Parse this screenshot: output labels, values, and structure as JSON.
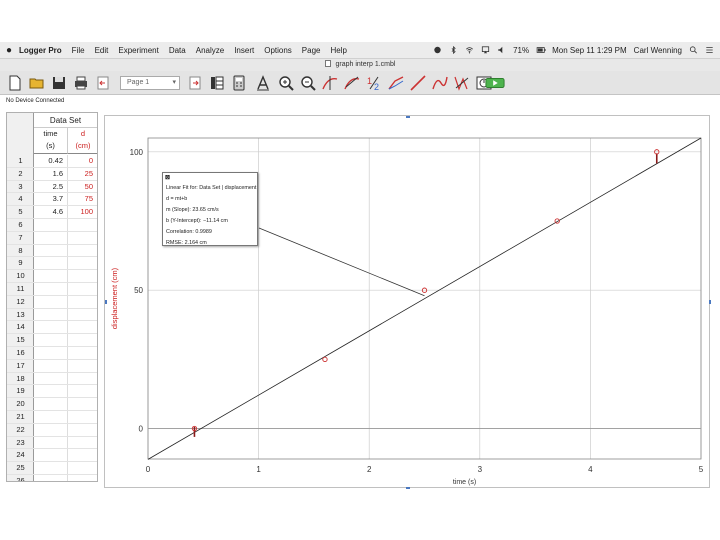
{
  "menubar": {
    "app_name": "Logger Pro",
    "items": [
      "File",
      "Edit",
      "Experiment",
      "Data",
      "Analyze",
      "Insert",
      "Options",
      "Page",
      "Help"
    ],
    "battery": "71%",
    "clock": "Mon Sep 11  1:29 PM",
    "user": "Carl Wenning"
  },
  "document": {
    "title": "graph interp 1.cmbl"
  },
  "toolbar": {
    "page_selector": "Page 1",
    "icons": [
      "new-file-icon",
      "open-folder-icon",
      "save-icon",
      "print-icon",
      "back-icon",
      "page-forward-icon",
      "data-browser-icon",
      "calculator-icon",
      "text-annotation-icon",
      "zoom-in-icon",
      "zoom-out-icon",
      "examine-icon",
      "tangent-icon",
      "integral-icon",
      "stats-icon",
      "linear-fit-icon",
      "curve-fit-icon",
      "model-icon",
      "replay-icon",
      "collect-icon"
    ]
  },
  "status": {
    "connection": "No Device Connected"
  },
  "table": {
    "title": "Data Set",
    "columns": [
      {
        "name": "time",
        "unit": "(s)"
      },
      {
        "name": "d",
        "unit": "(cm)"
      }
    ],
    "row_count": 26,
    "rows": [
      [
        "0.42",
        "0"
      ],
      [
        "1.6",
        "25"
      ],
      [
        "2.5",
        "50"
      ],
      [
        "3.7",
        "75"
      ],
      [
        "4.6",
        "100"
      ]
    ]
  },
  "fit_box": {
    "close_label": "⊠",
    "lines": [
      "Linear Fit for: Data Set | displacement",
      "d = mt+b",
      "m (Slope): 23.65 cm/s",
      "b (Y-Intercept): −11.14 cm",
      "Correlation: 0.9989",
      "RMSE: 2.164 cm"
    ]
  },
  "chart_data": {
    "type": "scatter",
    "xlabel": "time (s)",
    "ylabel": "displacement (cm)",
    "xlim": [
      0,
      5
    ],
    "ylim": [
      -11,
      105
    ],
    "x_ticks": [
      0,
      1,
      2,
      3,
      4,
      5
    ],
    "y_ticks": [
      0,
      50,
      100
    ],
    "grid": true,
    "series": [
      {
        "x": [
          0.42,
          1.6,
          2.5,
          3.7,
          4.6
        ],
        "y": [
          0,
          25,
          50,
          75,
          100
        ]
      }
    ],
    "fit": {
      "slope": 23.65,
      "intercept": -11.14
    },
    "fit_bracket_x": [
      0.42,
      4.6
    ],
    "colors": {
      "points": "#cc3030",
      "fit_line": "#222222",
      "grid": "#cccccc",
      "ylabel": "#cc2020"
    }
  }
}
